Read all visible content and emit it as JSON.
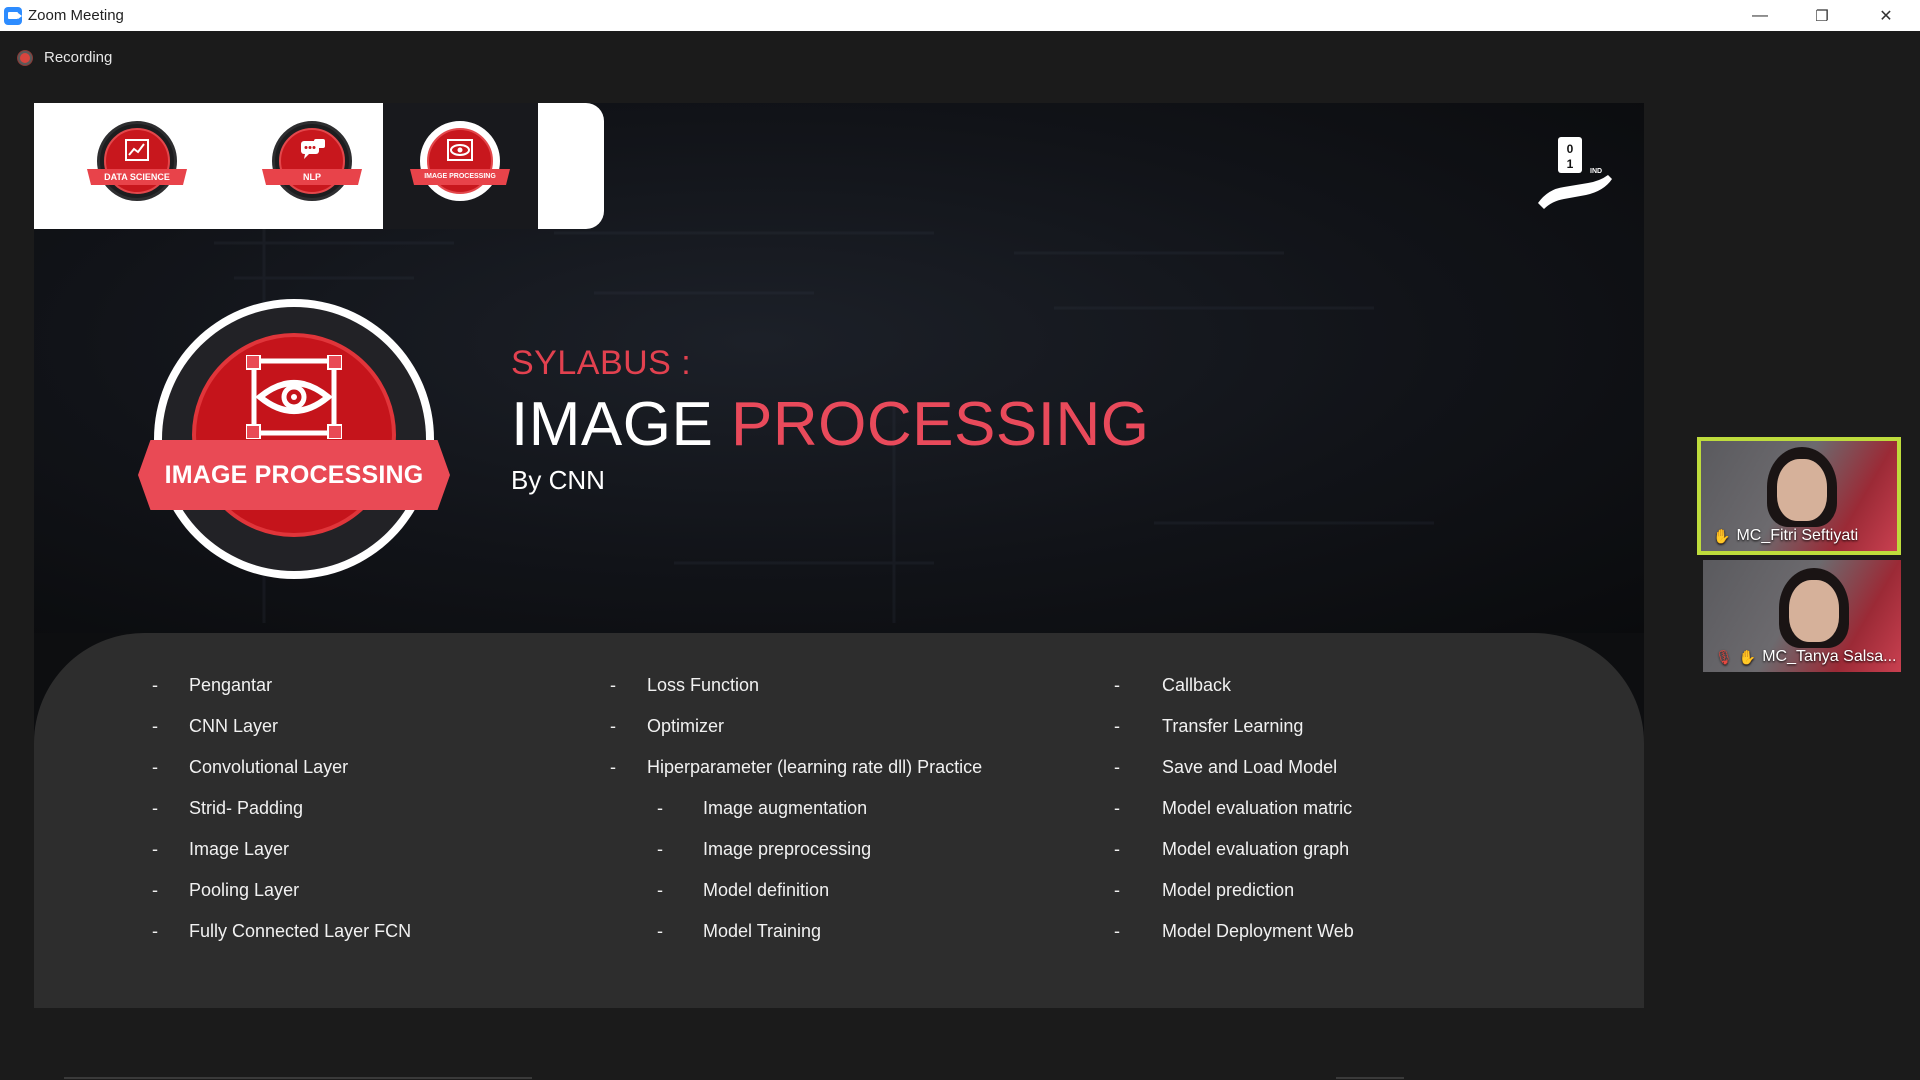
{
  "window": {
    "title": "Zoom Meeting",
    "minimize_glyph": "—",
    "restore_glyph": "❐",
    "close_glyph": "✕"
  },
  "meeting": {
    "recording_label": "Recording"
  },
  "slide": {
    "courses": [
      "DATA SCIENCE",
      "NLP",
      "IMAGE PROCESSING"
    ],
    "selected_course": "IMAGE PROCESSING",
    "brand_logo_text": "0 1 IND",
    "badge_label": "IMAGE PROCESSING",
    "sylabus_label": "SYLABUS :",
    "title_part1": "IMAGE",
    "title_part2": "PROCESSING",
    "subtitle": "By CNN",
    "columns": [
      [
        {
          "dash": "-",
          "text": "Pengantar"
        },
        {
          "dash": "-",
          "text": "CNN Layer"
        },
        {
          "dash": "-",
          "text": "Convolutional Layer"
        },
        {
          "dash": "-",
          "text": "Strid- Padding"
        },
        {
          "dash": "-",
          "text": "Image Layer"
        },
        {
          "dash": "-",
          "text": "Pooling Layer"
        },
        {
          "dash": "-",
          "text": "Fully Connected Layer FCN"
        }
      ],
      [
        {
          "dash": "-",
          "text": "Loss Function"
        },
        {
          "dash": "-",
          "text": "Optimizer"
        },
        {
          "dash": "-",
          "text": "Hiperparameter (learning rate dll) Practice"
        },
        {
          "dash": "-",
          "text": "Image augmentation"
        },
        {
          "dash": "-",
          "text": "Image preprocessing"
        },
        {
          "dash": "-",
          "text": "Model definition"
        },
        {
          "dash": "-",
          "text": "Model Training"
        }
      ],
      [
        {
          "dash": "-",
          "text": "Callback"
        },
        {
          "dash": "-",
          "text": "Transfer Learning"
        },
        {
          "dash": "-",
          "text": "Save and Load Model"
        },
        {
          "dash": "-",
          "text": "Model evaluation matric"
        },
        {
          "dash": "-",
          "text": "Model evaluation graph"
        },
        {
          "dash": "-",
          "text": "Model prediction"
        },
        {
          "dash": "-",
          "text": "Model Deployment Web"
        }
      ]
    ]
  },
  "participants": [
    {
      "name": "MC_Fitri Seftiyati",
      "active": true,
      "muted": false
    },
    {
      "name": "MC_Tanya Salsa...",
      "active": false,
      "muted": true
    }
  ],
  "colors": {
    "accent_red": "#e94a5b",
    "active_speaker_border": "#bedc3c",
    "recording_dot": "#d8453e"
  }
}
